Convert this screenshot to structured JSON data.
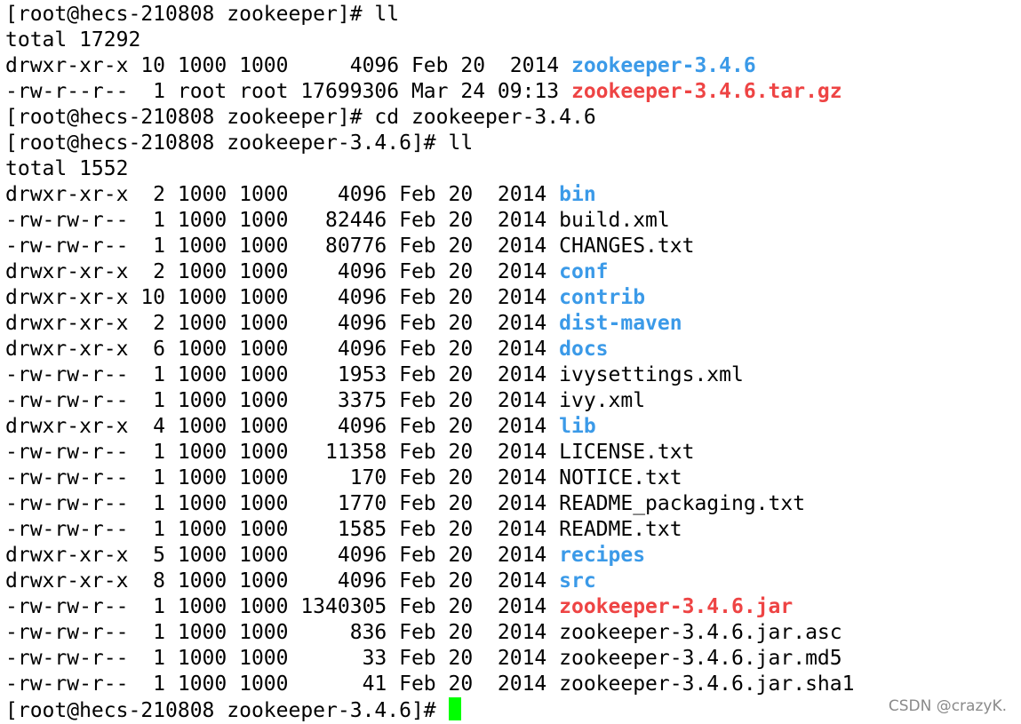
{
  "terminal": {
    "lines": [
      {
        "kind": "prompt",
        "prompt": "[root@hecs-210808 zookeeper]# ",
        "command": "ll"
      },
      {
        "kind": "text",
        "text": "total 17292"
      },
      {
        "kind": "entry",
        "meta": "drwxr-xr-x 10 1000 1000     4096 Feb 20  2014 ",
        "name": "zookeeper-3.4.6",
        "style": "dir"
      },
      {
        "kind": "entry",
        "meta": "-rw-r--r--  1 root root 17699306 Mar 24 09:13 ",
        "name": "zookeeper-3.4.6.tar.gz",
        "style": "archive"
      },
      {
        "kind": "prompt",
        "prompt": "[root@hecs-210808 zookeeper]# ",
        "command": "cd zookeeper-3.4.6"
      },
      {
        "kind": "prompt",
        "prompt": "[root@hecs-210808 zookeeper-3.4.6]# ",
        "command": "ll"
      },
      {
        "kind": "text",
        "text": "total 1552"
      },
      {
        "kind": "entry",
        "meta": "drwxr-xr-x  2 1000 1000    4096 Feb 20  2014 ",
        "name": "bin",
        "style": "dir"
      },
      {
        "kind": "entry",
        "meta": "-rw-rw-r--  1 1000 1000   82446 Feb 20  2014 ",
        "name": "build.xml",
        "style": "file"
      },
      {
        "kind": "entry",
        "meta": "-rw-rw-r--  1 1000 1000   80776 Feb 20  2014 ",
        "name": "CHANGES.txt",
        "style": "file"
      },
      {
        "kind": "entry",
        "meta": "drwxr-xr-x  2 1000 1000    4096 Feb 20  2014 ",
        "name": "conf",
        "style": "dir"
      },
      {
        "kind": "entry",
        "meta": "drwxr-xr-x 10 1000 1000    4096 Feb 20  2014 ",
        "name": "contrib",
        "style": "dir"
      },
      {
        "kind": "entry",
        "meta": "drwxr-xr-x  2 1000 1000    4096 Feb 20  2014 ",
        "name": "dist-maven",
        "style": "dir"
      },
      {
        "kind": "entry",
        "meta": "drwxr-xr-x  6 1000 1000    4096 Feb 20  2014 ",
        "name": "docs",
        "style": "dir"
      },
      {
        "kind": "entry",
        "meta": "-rw-rw-r--  1 1000 1000    1953 Feb 20  2014 ",
        "name": "ivysettings.xml",
        "style": "file"
      },
      {
        "kind": "entry",
        "meta": "-rw-rw-r--  1 1000 1000    3375 Feb 20  2014 ",
        "name": "ivy.xml",
        "style": "file"
      },
      {
        "kind": "entry",
        "meta": "drwxr-xr-x  4 1000 1000    4096 Feb 20  2014 ",
        "name": "lib",
        "style": "dir"
      },
      {
        "kind": "entry",
        "meta": "-rw-rw-r--  1 1000 1000   11358 Feb 20  2014 ",
        "name": "LICENSE.txt",
        "style": "file"
      },
      {
        "kind": "entry",
        "meta": "-rw-rw-r--  1 1000 1000     170 Feb 20  2014 ",
        "name": "NOTICE.txt",
        "style": "file"
      },
      {
        "kind": "entry",
        "meta": "-rw-rw-r--  1 1000 1000    1770 Feb 20  2014 ",
        "name": "README_packaging.txt",
        "style": "file"
      },
      {
        "kind": "entry",
        "meta": "-rw-rw-r--  1 1000 1000    1585 Feb 20  2014 ",
        "name": "README.txt",
        "style": "file"
      },
      {
        "kind": "entry",
        "meta": "drwxr-xr-x  5 1000 1000    4096 Feb 20  2014 ",
        "name": "recipes",
        "style": "dir"
      },
      {
        "kind": "entry",
        "meta": "drwxr-xr-x  8 1000 1000    4096 Feb 20  2014 ",
        "name": "src",
        "style": "dir"
      },
      {
        "kind": "entry",
        "meta": "-rw-rw-r--  1 1000 1000 1340305 Feb 20  2014 ",
        "name": "zookeeper-3.4.6.jar",
        "style": "archive"
      },
      {
        "kind": "entry",
        "meta": "-rw-rw-r--  1 1000 1000     836 Feb 20  2014 ",
        "name": "zookeeper-3.4.6.jar.asc",
        "style": "file"
      },
      {
        "kind": "entry",
        "meta": "-rw-rw-r--  1 1000 1000      33 Feb 20  2014 ",
        "name": "zookeeper-3.4.6.jar.md5",
        "style": "file"
      },
      {
        "kind": "entry",
        "meta": "-rw-rw-r--  1 1000 1000      41 Feb 20  2014 ",
        "name": "zookeeper-3.4.6.jar.sha1",
        "style": "file"
      },
      {
        "kind": "active-prompt",
        "prompt": "[root@hecs-210808 zookeeper-3.4.6]# "
      }
    ]
  },
  "colors": {
    "background": "#ffffff",
    "text": "#000000",
    "directory": "#3b9ae8",
    "archive": "#ee4444",
    "cursor": "#00ff00"
  },
  "watermark": "CSDN @crazyK."
}
